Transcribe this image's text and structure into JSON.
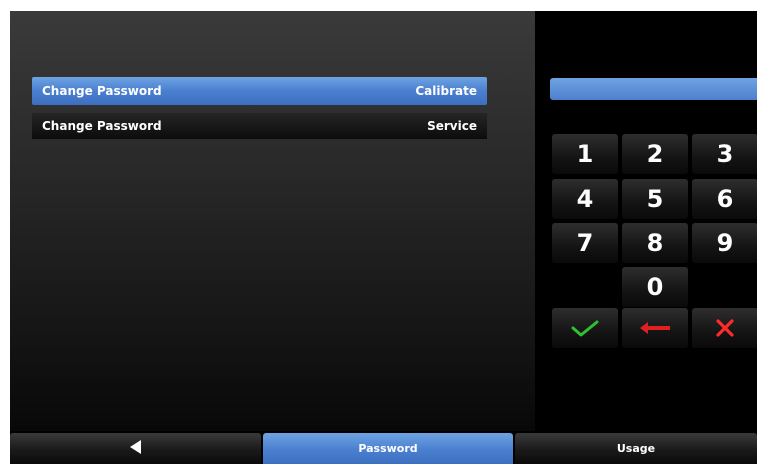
{
  "menu": {
    "items": [
      {
        "label": "Change Password",
        "value": "Calibrate",
        "selected": true
      },
      {
        "label": "Change Password",
        "value": "Service",
        "selected": false
      }
    ]
  },
  "keypad": {
    "entry_value": "",
    "keys": [
      "1",
      "2",
      "3",
      "4",
      "5",
      "6",
      "7",
      "8",
      "9",
      "0"
    ],
    "enter_icon": "checkmark-icon",
    "backspace_icon": "left-arrow-icon",
    "cancel_icon": "x-icon"
  },
  "bottom_tabs": {
    "back_icon": "back-arrow-icon",
    "password_label": "Password",
    "usage_label": "Usage"
  },
  "colors": {
    "accent": "#4a7fd0",
    "check": "#2fbf2f",
    "arrow": "#e02020",
    "cancel": "#ff2a2a"
  }
}
